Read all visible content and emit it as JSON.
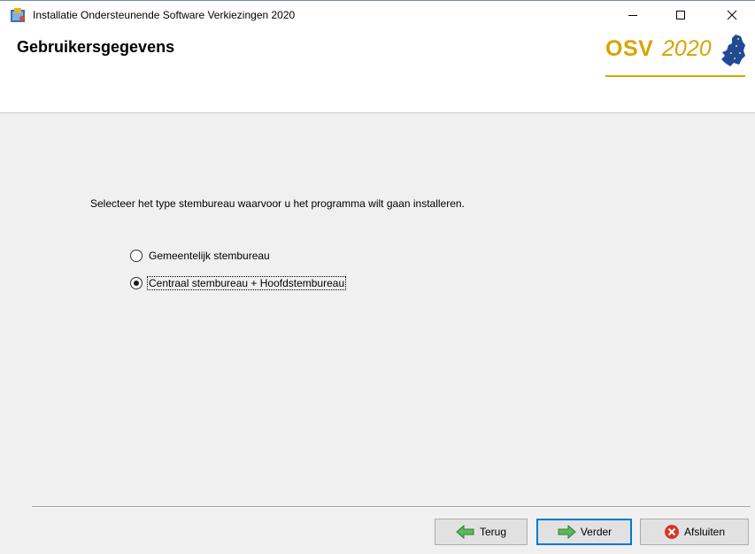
{
  "window": {
    "title": "Installatie Ondersteunende Software Verkiezingen 2020",
    "minimize_glyph": "minimize-icon",
    "maximize_glyph": "maximize-icon",
    "close_glyph": "close-icon"
  },
  "header": {
    "title": "Gebruikersgegevens",
    "logo_text": "OSV",
    "logo_year": "2020",
    "logo_color": "#d9a300"
  },
  "main": {
    "instruction": "Selecteer het type stembureau waarvoor u het programma wilt gaan installeren.",
    "options": [
      {
        "label": "Gemeentelijk stembureau",
        "selected": false
      },
      {
        "label": "Centraal stembureau + Hoofdstembureau",
        "selected": true
      }
    ]
  },
  "footer": {
    "back_label": "Terug",
    "next_label": "Verder",
    "close_label": "Afsluiten"
  }
}
